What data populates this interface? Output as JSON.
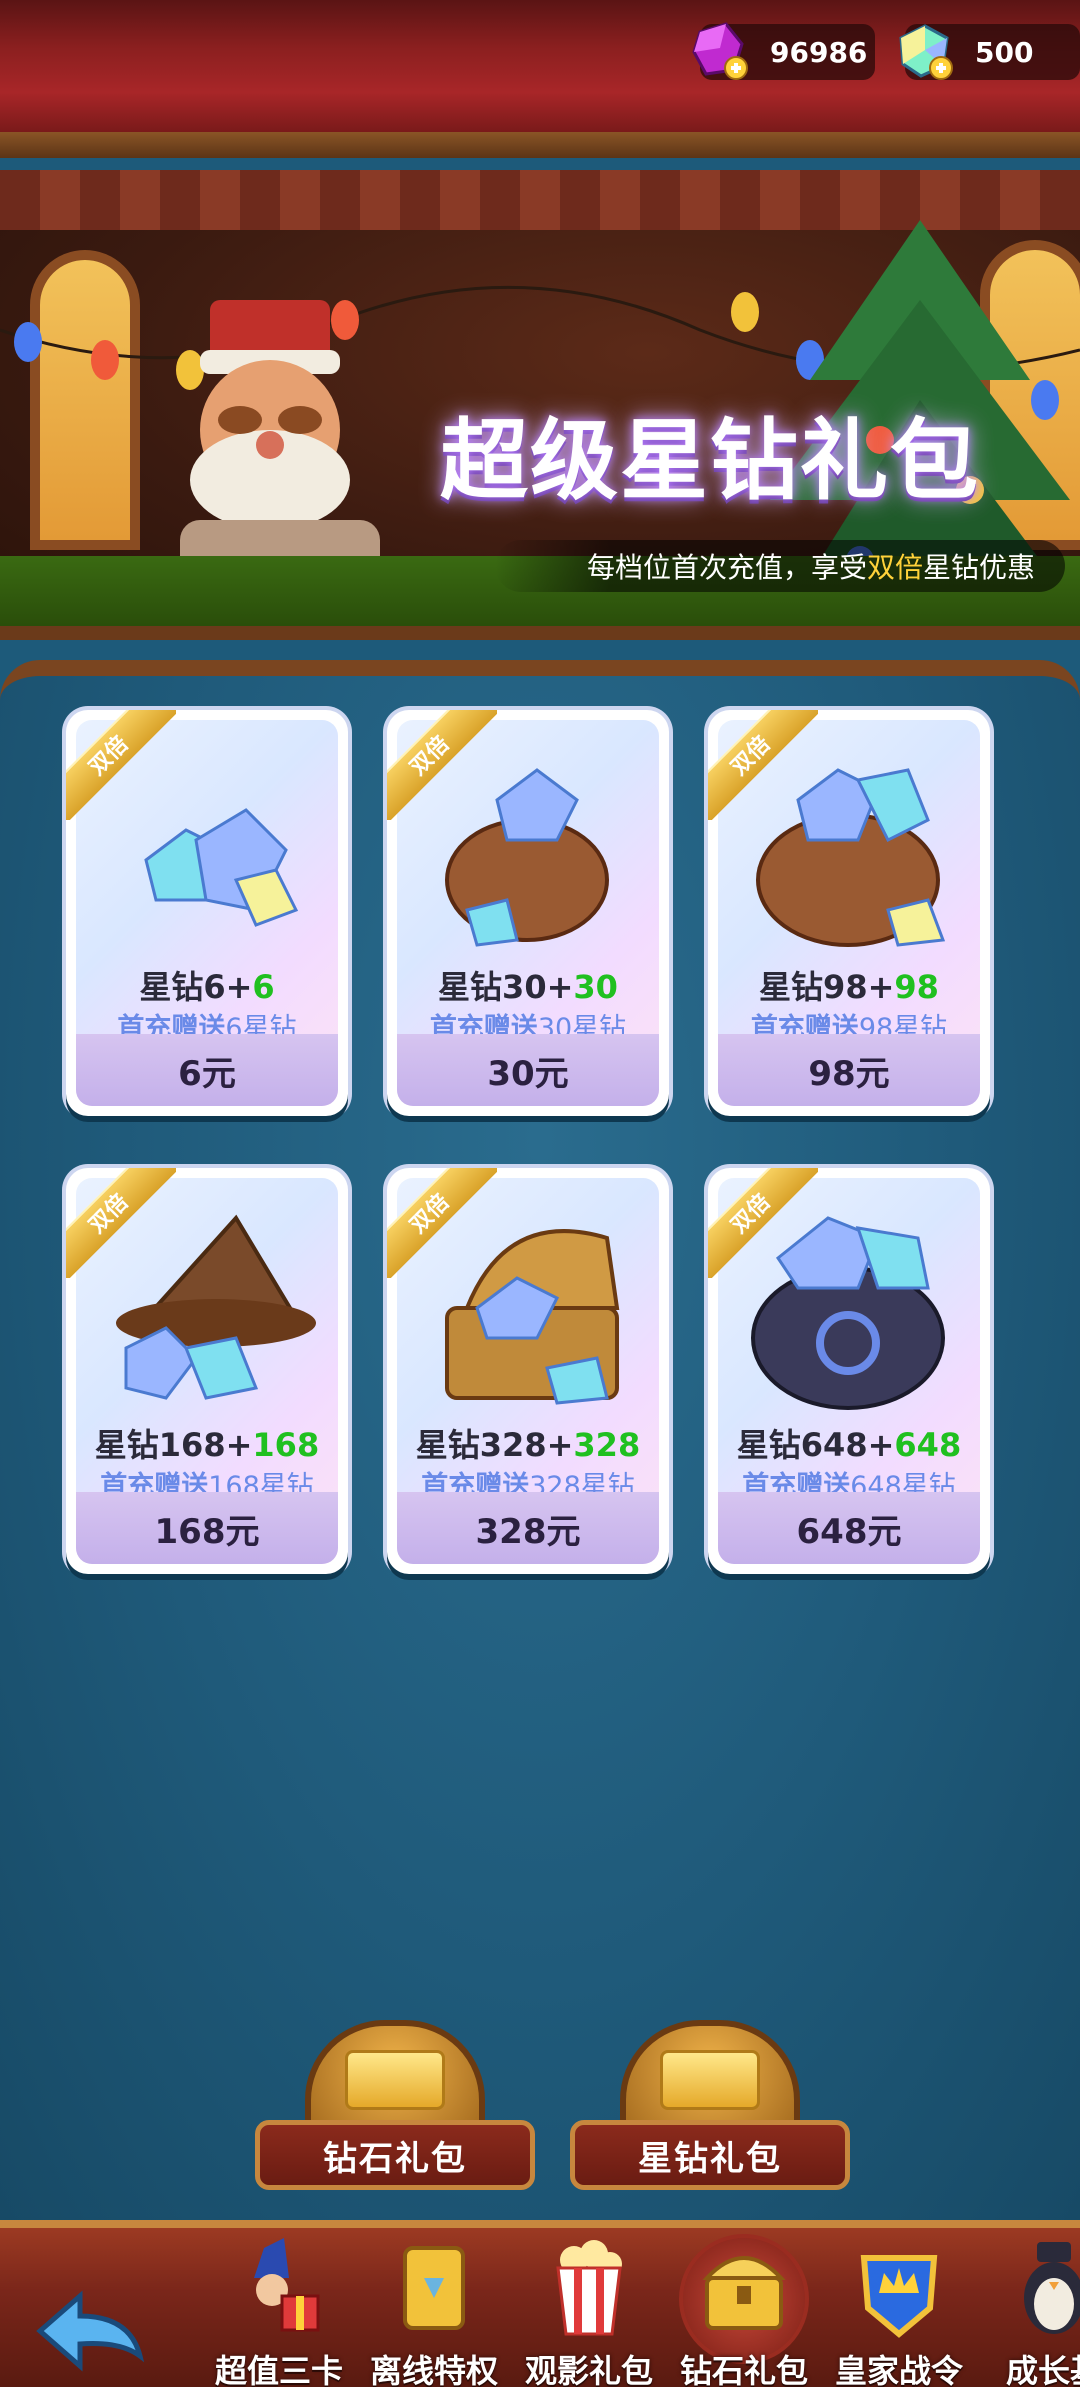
{
  "resources": [
    {
      "icon": "purple-gem-icon",
      "value": "96986"
    },
    {
      "icon": "star-diamond-icon",
      "value": "500"
    }
  ],
  "banner": {
    "title": "超级星钻礼包",
    "subtitle_pre": "每档位首次充值，享受",
    "subtitle_hl": "双倍",
    "subtitle_post": "星钻优惠"
  },
  "badge_label": "双倍",
  "packs": [
    {
      "base": "星钻6+",
      "bonus": "6",
      "gift_pre": "首充赠送",
      "gift_num": "6",
      "gift_post": "星钻",
      "price": "6元",
      "illus": "small-crystals-icon"
    },
    {
      "base": "星钻30+",
      "bonus": "30",
      "gift_pre": "首充赠送",
      "gift_num": "30",
      "gift_post": "星钻",
      "price": "30元",
      "illus": "small-sack-icon"
    },
    {
      "base": "星钻98+",
      "bonus": "98",
      "gift_pre": "首充赠送",
      "gift_num": "98",
      "gift_post": "星钻",
      "price": "98元",
      "illus": "large-sack-icon"
    },
    {
      "base": "星钻168+",
      "bonus": "168",
      "gift_pre": "首充赠送",
      "gift_num": "168",
      "gift_post": "星钻",
      "price": "168元",
      "illus": "wizard-hat-icon"
    },
    {
      "base": "星钻328+",
      "bonus": "328",
      "gift_pre": "首充赠送",
      "gift_num": "328",
      "gift_post": "星钻",
      "price": "328元",
      "illus": "treasure-chest-icon"
    },
    {
      "base": "星钻648+",
      "bonus": "648",
      "gift_pre": "首充赠送",
      "gift_num": "648",
      "gift_post": "星钻",
      "price": "648元",
      "illus": "cauldron-icon"
    }
  ],
  "tabs": [
    {
      "label": "钻石礼包"
    },
    {
      "label": "星钻礼包"
    }
  ],
  "nav": [
    {
      "label": "超值三卡",
      "icon": "wizard-gift-icon"
    },
    {
      "label": "离线特权",
      "icon": "scroll-icon"
    },
    {
      "label": "观影礼包",
      "icon": "popcorn-icon"
    },
    {
      "label": "钻石礼包",
      "icon": "chest-icon",
      "active": true
    },
    {
      "label": "皇家战令",
      "icon": "crown-shield-icon"
    },
    {
      "label": "成长基",
      "icon": "penguin-icon"
    }
  ],
  "colors": {
    "bonus_green": "#20c020",
    "gift_blue": "#6a8ae8",
    "highlight_yellow": "#ffd23a",
    "panel_blue": "#1f5a7a"
  }
}
